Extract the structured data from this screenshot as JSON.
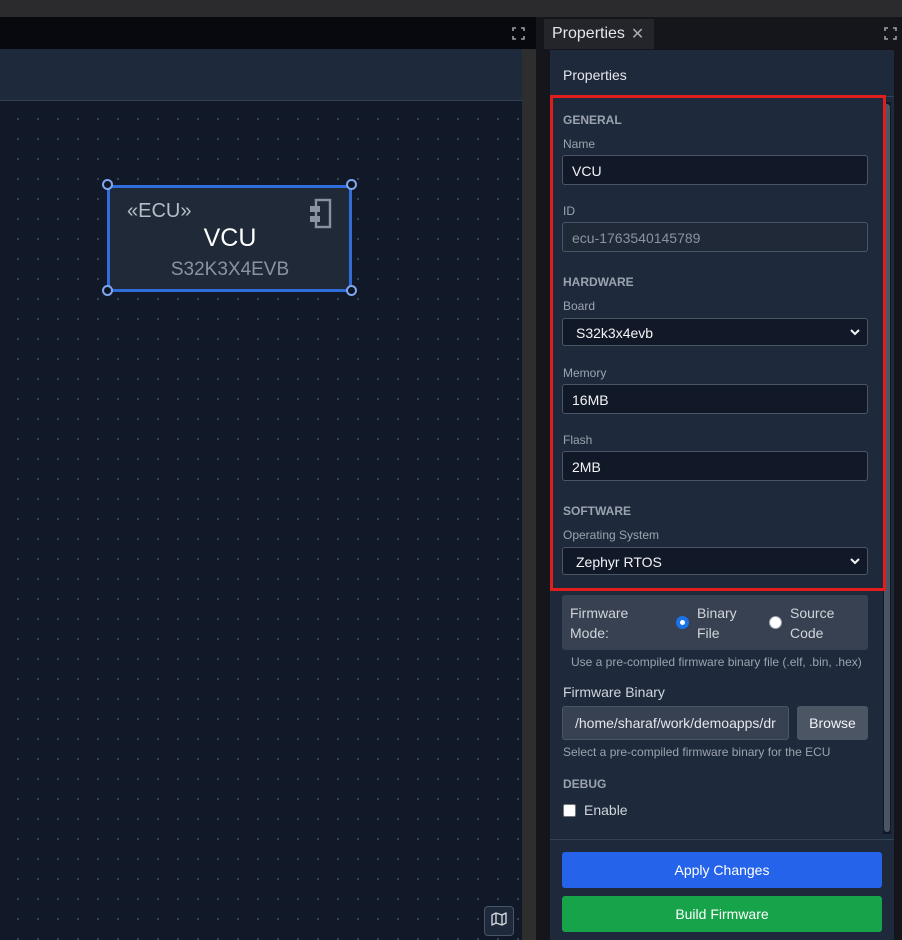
{
  "canvas": {
    "node": {
      "stereotype": "«ECU»",
      "name": "VCU",
      "board": "S32K3X4EVB"
    },
    "icons": [
      "component-icon",
      "maximize-icon",
      "map-icon"
    ]
  },
  "panel": {
    "tab_label": "Properties",
    "title": "Properties",
    "general": {
      "section": "GENERAL",
      "name_label": "Name",
      "name_value": "VCU",
      "id_label": "ID",
      "id_value": "ecu-1763540145789"
    },
    "hardware": {
      "section": "HARDWARE",
      "board_label": "Board",
      "board_value": "S32k3x4evb",
      "memory_label": "Memory",
      "memory_value": "16MB",
      "flash_label": "Flash",
      "flash_value": "2MB"
    },
    "software": {
      "section": "SOFTWARE",
      "os_label": "Operating System",
      "os_value": "Zephyr RTOS",
      "firmware_mode_label": "Firmware Mode:",
      "mode_binary": "Binary File",
      "mode_source": "Source Code",
      "mode_selected": "Binary File",
      "mode_hint": "Use a pre-compiled firmware binary file (.elf, .bin, .hex)",
      "firmware_binary_label": "Firmware Binary",
      "firmware_binary_value": "/home/sharaf/work/demoapps/dr",
      "browse_label": "Browse",
      "binary_hint": "Select a pre-compiled firmware binary for the ECU"
    },
    "debug": {
      "section": "DEBUG",
      "enable_label": "Enable",
      "enabled": false
    },
    "buttons": {
      "apply": "Apply Changes",
      "build": "Build Firmware"
    }
  },
  "colors": {
    "accent": "#2563eb",
    "build": "#16a34a",
    "highlight": "#e11d1d",
    "selection": "#2f6ddb"
  }
}
